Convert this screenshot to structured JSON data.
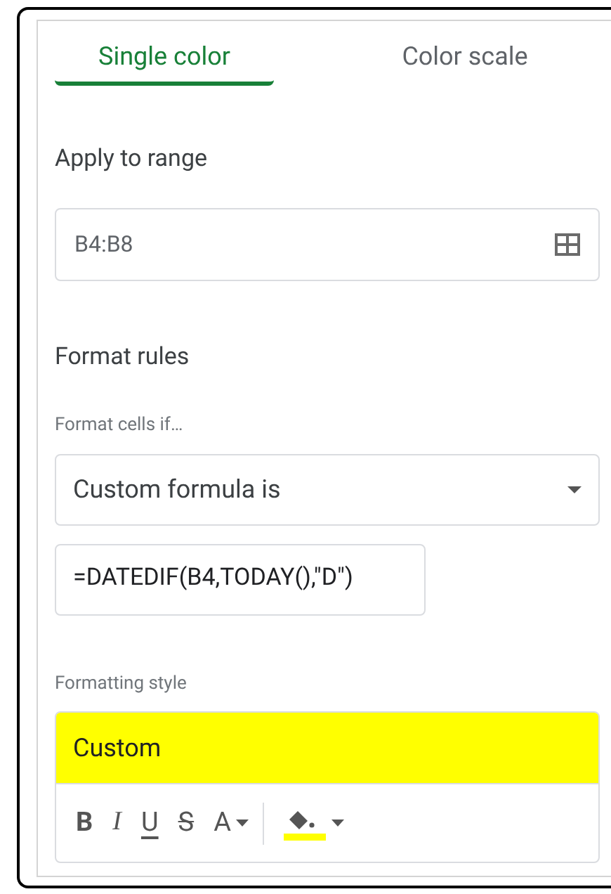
{
  "tabs": [
    {
      "label": "Single color",
      "selected": true
    },
    {
      "label": "Color scale",
      "selected": false
    }
  ],
  "apply_to_range": {
    "heading": "Apply to range",
    "value": "B4:B8"
  },
  "format_rules": {
    "heading": "Format rules",
    "condition_label": "Format cells if…",
    "condition": "Custom formula is",
    "formula": "=DATEDIF(B4,TODAY(),\"D\")"
  },
  "formatting_style": {
    "label": "Formatting style",
    "preview": "Custom",
    "color": "#ffff00",
    "toolbar": [
      {
        "kind": "bold",
        "label": "B"
      },
      {
        "kind": "italic",
        "label": "I"
      },
      {
        "kind": "underline",
        "label": "U"
      },
      {
        "kind": "strikethrough",
        "label": "S"
      },
      {
        "kind": "text_color",
        "label": "A"
      },
      {
        "kind": "fill_color",
        "color": "#ffff00"
      }
    ]
  }
}
